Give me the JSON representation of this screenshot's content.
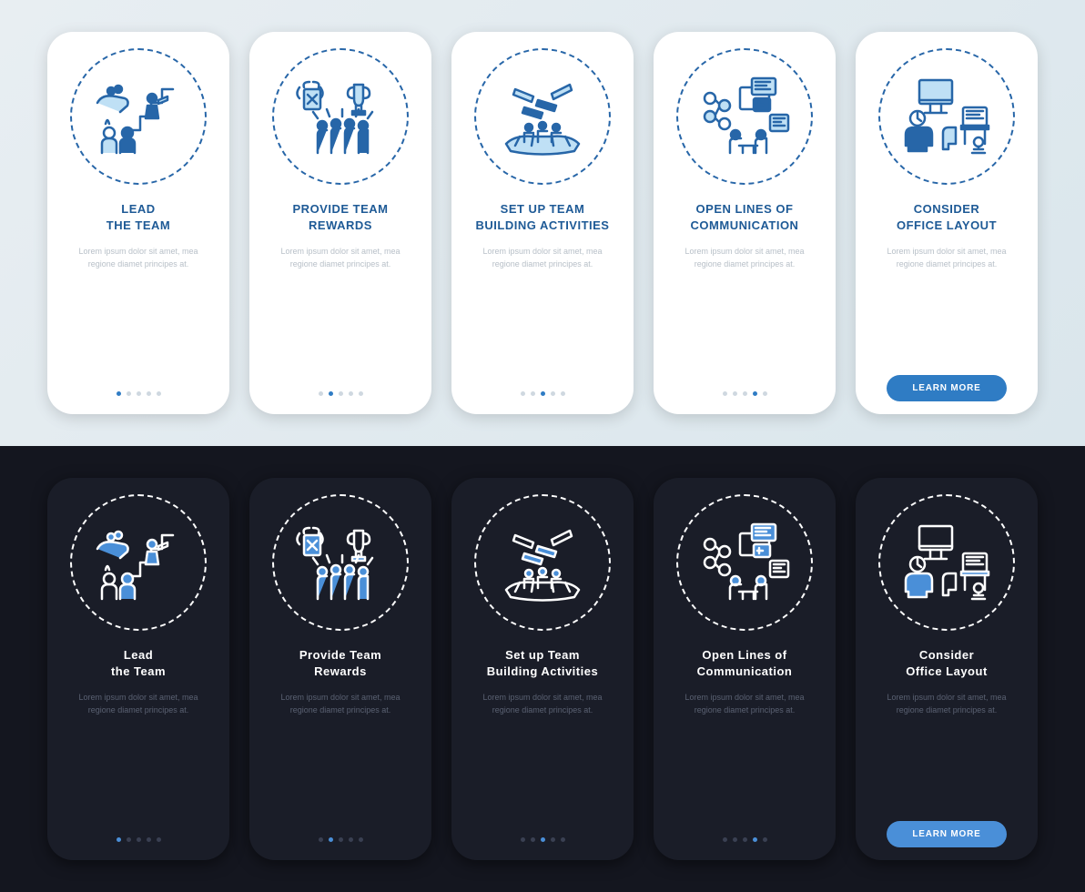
{
  "lorem": "Lorem ipsum dolor sit amet, mea regione diamet principes at.",
  "button_label": "LEARN MORE",
  "light": {
    "screens": [
      {
        "title": "LEAD\nTHE TEAM",
        "active": 0
      },
      {
        "title": "PROVIDE TEAM\nREWARDS",
        "active": 1
      },
      {
        "title": "SET UP TEAM\nBUILDING ACTIVITIES",
        "active": 2
      },
      {
        "title": "OPEN LINES OF\nCOMMUNICATION",
        "active": 3
      },
      {
        "title": "CONSIDER\nOFFICE LAYOUT",
        "active": 4,
        "button": true
      }
    ]
  },
  "dark": {
    "screens": [
      {
        "title": "Lead\nthe Team",
        "active": 0
      },
      {
        "title": "Provide Team\nRewards",
        "active": 1
      },
      {
        "title": "Set up Team\nBuilding Activities",
        "active": 2
      },
      {
        "title": "Open Lines of\nCommunication",
        "active": 3
      },
      {
        "title": "Consider\nOffice Layout",
        "active": 4,
        "button": true
      }
    ]
  }
}
